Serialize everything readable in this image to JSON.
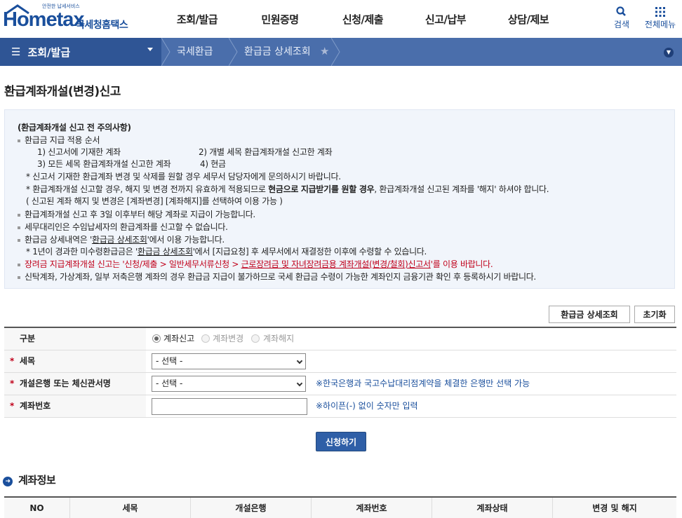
{
  "header": {
    "logo_small": "안전한 납세서비스",
    "logo_main": "Hometax",
    "logo_ko": "국세청홈택스",
    "nav": [
      "조회/발급",
      "민원증명",
      "신청/제출",
      "신고/납부",
      "상담/제보"
    ],
    "search_label": "검색",
    "menu_label": "전체메뉴"
  },
  "breadcrumb": {
    "home": "조회/발급",
    "items": [
      "국세환급",
      "환급금 상세조회"
    ]
  },
  "page_title": "환급계좌개설(변경)신고",
  "notice": {
    "heading": "(환급계좌개설 신고 전 주의사항)",
    "order_title": "환급금 지급 적용 순서",
    "order_1": "1) 신고서에 기재한 계좌",
    "order_2": "2) 개별 세목 환급계좌개설 신고한 계좌",
    "order_3": "3) 모든 세목 환급계좌개설 신고한 계좌",
    "order_4": "4) 현금",
    "note_1": "* 신고서 기재한 환급계좌 변경 및 삭제를 원할 경우 세무서 담당자에게 문의하시기 바랍니다.",
    "note_2a": "* 환급계좌개설 신고할 경우, 해지 및 변경 전까지 유효하게 적용되므로 ",
    "note_2b": "현금으로 지급받기를 원할 경우",
    "note_2c": ", 환급계좌개설 신고된 계좌를 '해지' 하셔야 합니다.",
    "note_3": "( 신고된 계좌 해지 및 변경은 [계좌변경] [계좌해지]를 선택하여 이용 가능 )",
    "item_1": "환급계좌개설 신고 후 3일 이후부터 해당 계좌로 지급이 가능합니다.",
    "item_2": "세무대리인은 수임납세자의 환급계좌를 신고할 수 없습니다.",
    "item_3a": "환급금 상세내역은 '",
    "item_3b": "환급금 상세조회",
    "item_3c": "'에서 이용 가능합니다.",
    "item_3_sub_a": "* 1년이 경과한 미수령환급금은 '",
    "item_3_sub_b": "환급금 상세조회",
    "item_3_sub_c": "'에서 [지급요청] 후 세무서에서 재결정한 이후에 수령할 수 있습니다.",
    "item_4a": "장려금 지급계좌개설 신고는 '신청/제출 > 일반세무서류신청 > ",
    "item_4b": "근로장려금 및 자녀장려금용 계좌개설(변경/철회)신고서",
    "item_4c": "'를 이용 바랍니다.",
    "item_5": "신탁계좌, 가상계좌, 일부 저축은행 계좌의 경우 환급금 지급이 불가하므로 국세 환급금 수령이 가능한 계좌인지 금융기관 확인 후 등록하시기 바랍니다."
  },
  "buttons": {
    "lookup": "환급금 상세조회",
    "reset": "초기화",
    "submit": "신청하기"
  },
  "form": {
    "type_label": "구분",
    "type_options": [
      "계좌신고",
      "계좌변경",
      "계좌해지"
    ],
    "tax_label": "세목",
    "tax_value": "- 선택 -",
    "bank_label": "개설은행 또는 체신관서명",
    "bank_value": "- 선택 -",
    "bank_hint": "※한국은행과 국고수납대리점계약을 체결한 은행만 선택 가능",
    "account_label": "계좌번호",
    "account_hint": "※하이픈(-) 없이 숫자만 입력",
    "required_mark": "*"
  },
  "account_info": {
    "title": "계좌정보",
    "columns": [
      "NO",
      "세목",
      "개설은행",
      "계좌번호",
      "계좌상태",
      "변경 및 해지"
    ]
  }
}
